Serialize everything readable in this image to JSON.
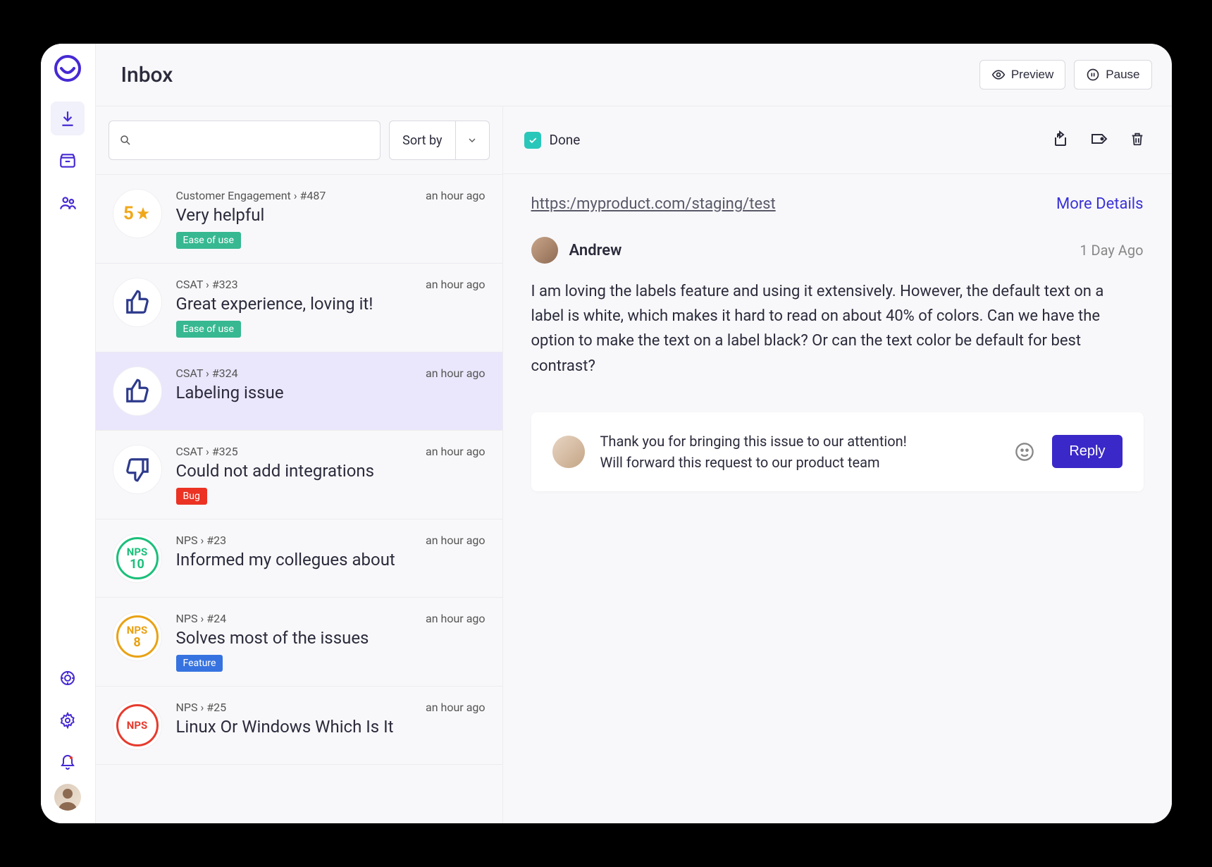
{
  "header": {
    "title": "Inbox"
  },
  "top_actions": {
    "preview": "Preview",
    "pause": "Pause"
  },
  "list_toolbar": {
    "sort_label": "Sort by"
  },
  "done_label": "Done",
  "items": [
    {
      "meta": "Customer Engagement › #487",
      "time": "an hour ago",
      "title": "Very helpful",
      "tag": "Ease of use",
      "tag_class": "tag-green",
      "badge_type": "star",
      "star_score": "5"
    },
    {
      "meta": "CSAT › #323",
      "time": "an hour ago",
      "title": "Great experience, loving it!",
      "tag": "Ease of use",
      "tag_class": "tag-green",
      "badge_type": "thumbs-up"
    },
    {
      "meta": "CSAT › #324",
      "time": "an hour ago",
      "title": "Labeling issue",
      "badge_type": "thumbs-up",
      "selected": true
    },
    {
      "meta": "CSAT › #325",
      "time": "an hour ago",
      "title": "Could not add integrations",
      "tag": "Bug",
      "tag_class": "tag-red",
      "badge_type": "thumbs-down"
    },
    {
      "meta": "NPS › #23",
      "time": "an hour ago",
      "title": "Informed my collegues about",
      "badge_type": "nps",
      "nps_class": "nps-green",
      "nps_score": "10"
    },
    {
      "meta": "NPS › #24",
      "time": "an hour ago",
      "title": "Solves most of the issues",
      "tag": "Feature",
      "tag_class": "tag-blue",
      "badge_type": "nps",
      "nps_class": "nps-orange",
      "nps_score": "8"
    },
    {
      "meta": "NPS › #25",
      "time": "an hour ago",
      "title": "Linux Or Windows Which Is It",
      "badge_type": "nps",
      "nps_class": "nps-red",
      "nps_score": ""
    }
  ],
  "detail": {
    "url": "https:/myproduct.com/staging/test",
    "more": "More Details",
    "author": "Andrew",
    "when": "1 Day Ago",
    "message": "I am loving the labels feature and using it extensively.  However, the default text on a label is white, which makes it hard to read on about 40% of colors.  Can we have the option to make the text on a label black?  Or can the text color be default for best contrast?",
    "reply_draft": "Thank you for bringing this issue to our attention!\nWill forward this request to our product team",
    "reply_btn": "Reply"
  },
  "nps_label": "NPS"
}
